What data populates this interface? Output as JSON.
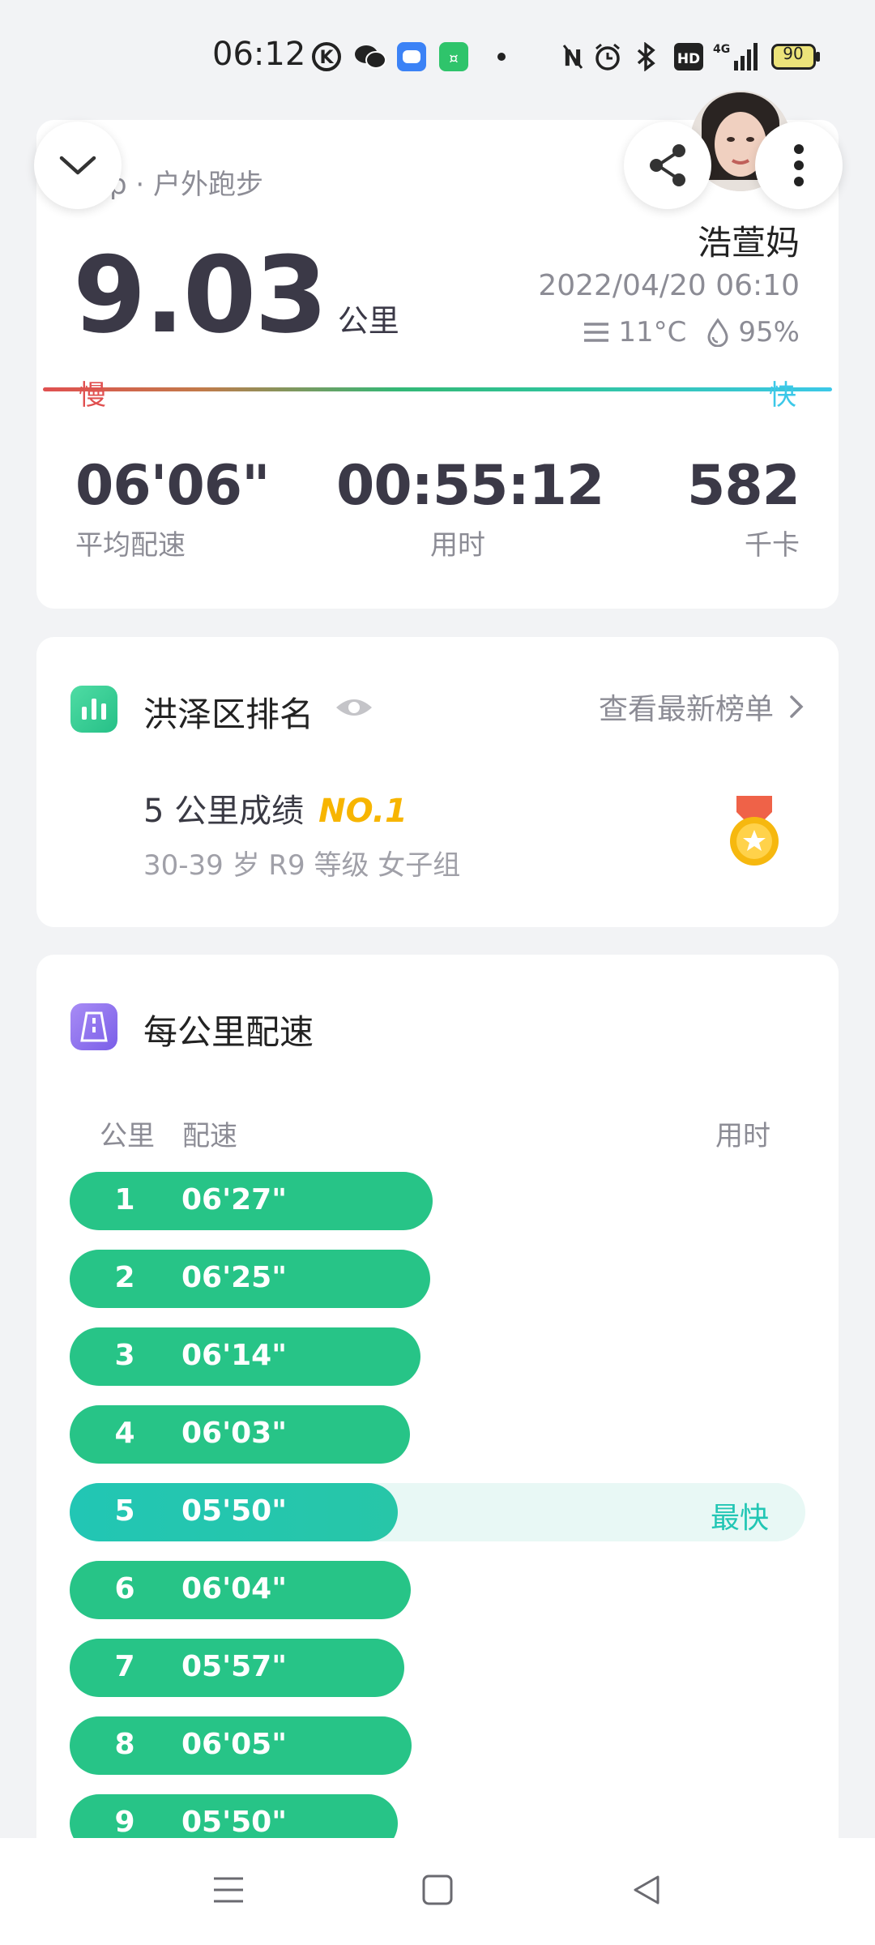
{
  "status_bar": {
    "time": "06:12",
    "battery": "90",
    "network": "4G"
  },
  "summary": {
    "activity_type": "p · 户外跑步",
    "distance": "9.03",
    "distance_unit": "公里",
    "user_name": "浩萱妈",
    "datetime": "2022/04/20 06:10",
    "temperature": "11°C",
    "humidity": "95%",
    "slow_label": "慢",
    "fast_label": "快",
    "stats": [
      {
        "value": "06'06\"",
        "label": "平均配速"
      },
      {
        "value": "00:55:12",
        "label": "用时"
      },
      {
        "value": "582",
        "label": "千卡"
      }
    ]
  },
  "ranking": {
    "title": "洪泽区排名",
    "link": "查看最新榜单",
    "achievement": "5 公里成绩",
    "rank": "NO.1",
    "group": "30-39 岁 R9 等级 女子组"
  },
  "pace_section": {
    "title": "每公里配速",
    "col_km": "公里",
    "col_pace": "配速",
    "col_time": "用时",
    "fastest_label": "最快",
    "rows": [
      {
        "km": "1",
        "pace": "06'27\"",
        "fraction": 1.0
      },
      {
        "km": "2",
        "pace": "06'25\"",
        "fraction": 0.994
      },
      {
        "km": "3",
        "pace": "06'14\"",
        "fraction": 0.966
      },
      {
        "km": "4",
        "pace": "06'03\"",
        "fraction": 0.937
      },
      {
        "km": "5",
        "pace": "05'50\"",
        "fraction": 0.904,
        "fastest": true
      },
      {
        "km": "6",
        "pace": "06'04\"",
        "fraction": 0.94
      },
      {
        "km": "7",
        "pace": "05'57\"",
        "fraction": 0.922
      },
      {
        "km": "8",
        "pace": "06'05\"",
        "fraction": 0.943
      },
      {
        "km": "9",
        "pace": "05'50\"",
        "fraction": 0.904
      }
    ]
  },
  "colors": {
    "accent_green": "#27c487",
    "fastest_teal": "#22c6b4",
    "rank_gold": "#f7b500",
    "slow_red": "#e05050",
    "fast_cyan": "#3cc8e8"
  },
  "icons": {
    "collapse": "chevron-down-icon",
    "share": "share-icon",
    "more": "more-vertical-icon",
    "ranking": "bar-chart-icon",
    "visibility": "eye-icon",
    "pace": "road-icon",
    "medal": "medal-icon"
  }
}
